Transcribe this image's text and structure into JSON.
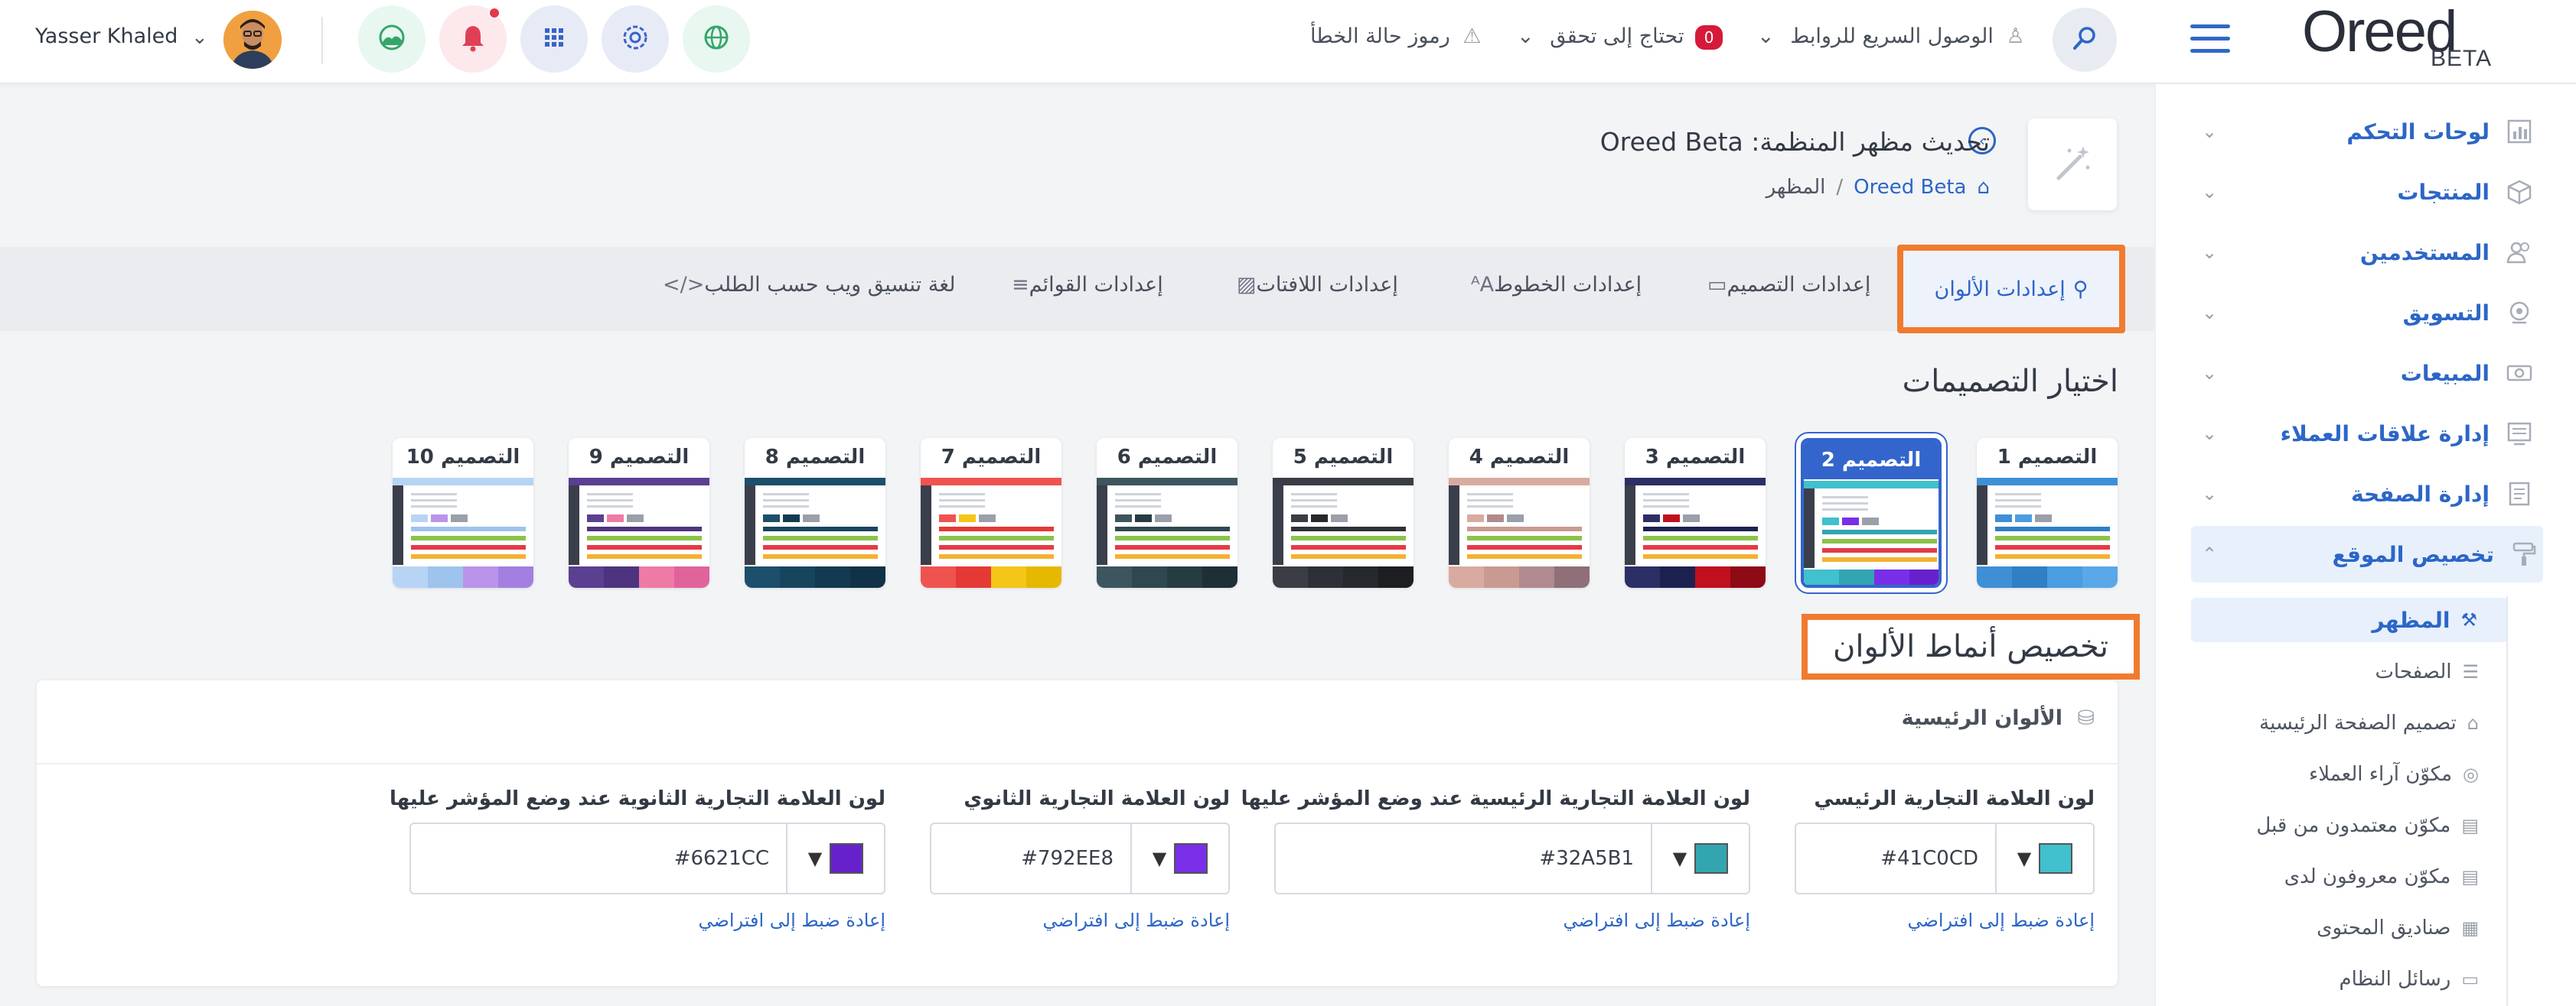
{
  "topbar": {
    "user_name": "Yasser Khaled",
    "error_codes": "رموز حالة الخطأ",
    "needs_check": "تحتاج إلى تحقق",
    "needs_check_count": "0",
    "quick_access": "الوصول السريع للروابط"
  },
  "logo": {
    "word": "Oreed",
    "beta": "BETA"
  },
  "sidebar": {
    "items": [
      {
        "label": "لوحات التحكم"
      },
      {
        "label": "المنتجات"
      },
      {
        "label": "المستخدمين"
      },
      {
        "label": "التسويق"
      },
      {
        "label": "المبيعات"
      },
      {
        "label": "إدارة علاقات العملاء"
      },
      {
        "label": "إدارة الصفحة"
      },
      {
        "label": "تخصيص الموقع"
      }
    ],
    "sub_items": [
      {
        "label": "المظهر"
      },
      {
        "label": "الصفحات"
      },
      {
        "label": "تصميم الصفحة الرئيسية"
      },
      {
        "label": "مكوّن آراء العملاء"
      },
      {
        "label": "مكوّن معتمدون من قبل"
      },
      {
        "label": "مكوّن معروفون لدى"
      },
      {
        "label": "صناديق المحتوى"
      },
      {
        "label": "رسائل النظام"
      }
    ]
  },
  "page": {
    "title": "تحديث مظهر المنظمة: Oreed Beta",
    "breadcrumb": {
      "link": "Oreed Beta",
      "current": "المظهر"
    }
  },
  "tabs": [
    {
      "label": "إعدادات الألوان"
    },
    {
      "label": "إعدادات التصميم"
    },
    {
      "label": "إعدادات الخطوط"
    },
    {
      "label": "إعدادات اللافتات"
    },
    {
      "label": "إعدادات القوائم"
    },
    {
      "label": "لغة تنسيق ويب حسب الطلب"
    }
  ],
  "designs": {
    "heading": "اختيار التصميمات",
    "selected_index": 1,
    "cards": [
      {
        "label": "التصميم 1",
        "colors": [
          "#3f8fd6",
          "#2f7fc4",
          "#4a9de0",
          "#5aa8e8"
        ],
        "accent": "#3f8fd6"
      },
      {
        "label": "التصميم 2",
        "colors": [
          "#41C0CD",
          "#32A5B1",
          "#792EE8",
          "#6621CC"
        ],
        "accent": "#41C0CD"
      },
      {
        "label": "التصميم 3",
        "colors": [
          "#2b2f66",
          "#1d2150",
          "#c0101e",
          "#8e0a14"
        ],
        "accent": "#c0101e"
      },
      {
        "label": "التصميم 4",
        "colors": [
          "#d9aaa0",
          "#c99a92",
          "#b08a8e",
          "#8f6f78"
        ],
        "accent": "#d9aaa0"
      },
      {
        "label": "التصميم 5",
        "colors": [
          "#3a3d44",
          "#2d3036",
          "#25282d",
          "#1c1e22"
        ],
        "accent": "#3a3d44"
      },
      {
        "label": "التصميم 6",
        "colors": [
          "#3c555e",
          "#2f4850",
          "#263c43",
          "#1e3036"
        ],
        "accent": "#3c555e"
      },
      {
        "label": "التصميم 7",
        "colors": [
          "#ef5350",
          "#e53935",
          "#f5c518",
          "#e6b800"
        ],
        "accent": "#ef5350"
      },
      {
        "label": "التصميم 8",
        "colors": [
          "#1c4f6b",
          "#17455e",
          "#123a50",
          "#0f3246"
        ],
        "accent": "#1c4f6b"
      },
      {
        "label": "التصميم 9",
        "colors": [
          "#5b3f91",
          "#4e347e",
          "#ee7aa6",
          "#e0649a"
        ],
        "accent": "#5b3f91"
      },
      {
        "label": "التصميم 10",
        "colors": [
          "#b7d4f4",
          "#9ec3ec",
          "#b994ea",
          "#a47ee0"
        ],
        "accent": "#9ec3ec"
      }
    ]
  },
  "custom": {
    "heading": "تخصيص أنماط الألوان",
    "panel_title": "الألوان الرئيسية",
    "reset_label": "إعادة ضبط إلى افتراضي",
    "fields": [
      {
        "label": "لون العلامة التجارية الرئيسي",
        "value": "#41C0CD",
        "color": "#41C0CD"
      },
      {
        "label": "لون العلامة التجارية الرئيسية عند وضع المؤشر عليها",
        "value": "#32A5B1",
        "color": "#32A5B1"
      },
      {
        "label": "لون العلامة التجارية الثانوي",
        "value": "#792EE8",
        "color": "#792EE8"
      },
      {
        "label": "لون العلامة التجارية الثانوية عند وضع المؤشر عليها",
        "value": "#6621CC",
        "color": "#6621CC"
      }
    ]
  }
}
